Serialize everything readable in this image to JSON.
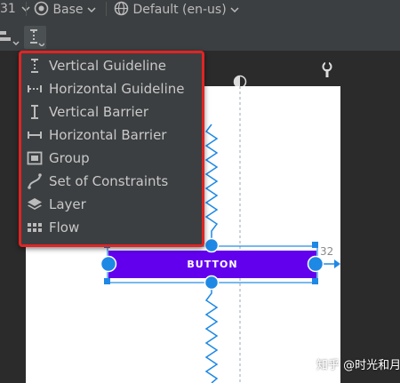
{
  "topbar": {
    "api_partial": "31",
    "theme": "Base",
    "locale": "Default (en-us)"
  },
  "menu": {
    "items": [
      {
        "label": "Vertical Guideline",
        "icon": "vertical-guideline-icon"
      },
      {
        "label": "Horizontal Guideline",
        "icon": "horizontal-guideline-icon"
      },
      {
        "label": "Vertical Barrier",
        "icon": "vertical-barrier-icon"
      },
      {
        "label": "Horizontal Barrier",
        "icon": "horizontal-barrier-icon"
      },
      {
        "label": "Group",
        "icon": "group-icon"
      },
      {
        "label": "Set of Constraints",
        "icon": "constraints-icon"
      },
      {
        "label": "Layer",
        "icon": "layer-icon"
      },
      {
        "label": "Flow",
        "icon": "flow-icon"
      }
    ]
  },
  "canvas": {
    "button_label": "BUTTON",
    "badge": "32"
  },
  "watermark": "知乎 @时光和月云",
  "colors": {
    "highlight_border": "#e02424",
    "constraint_blue": "#1a73e8",
    "button_purple": "#6200ee"
  }
}
